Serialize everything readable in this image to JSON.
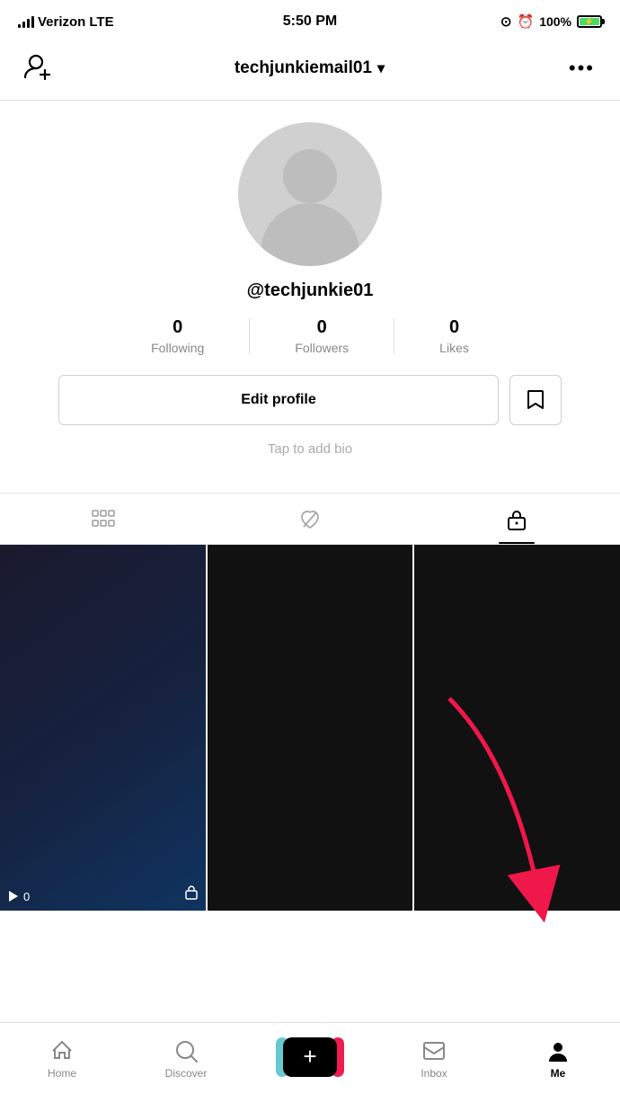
{
  "statusBar": {
    "carrier": "Verizon",
    "network": "LTE",
    "time": "5:50 PM",
    "batteryPercent": "100%",
    "icons": {
      "lock": "⊙",
      "alarm": "⏰"
    }
  },
  "topNav": {
    "addUserIcon": "add-user",
    "username": "techjunkiemail01",
    "dropdownIcon": "▾",
    "moreIcon": "•••"
  },
  "profile": {
    "handle": "@techjunkie01",
    "stats": {
      "following": {
        "count": "0",
        "label": "Following"
      },
      "followers": {
        "count": "0",
        "label": "Followers"
      },
      "likes": {
        "count": "0",
        "label": "Likes"
      }
    },
    "editProfileLabel": "Edit profile",
    "bioPlaceholder": "Tap to add bio"
  },
  "tabs": {
    "videos": "videos-tab",
    "liked": "liked-tab",
    "private": "private-tab"
  },
  "bottomNav": {
    "home": {
      "label": "Home"
    },
    "discover": {
      "label": "Discover"
    },
    "create": {
      "label": ""
    },
    "inbox": {
      "label": "Inbox"
    },
    "me": {
      "label": "Me"
    }
  }
}
